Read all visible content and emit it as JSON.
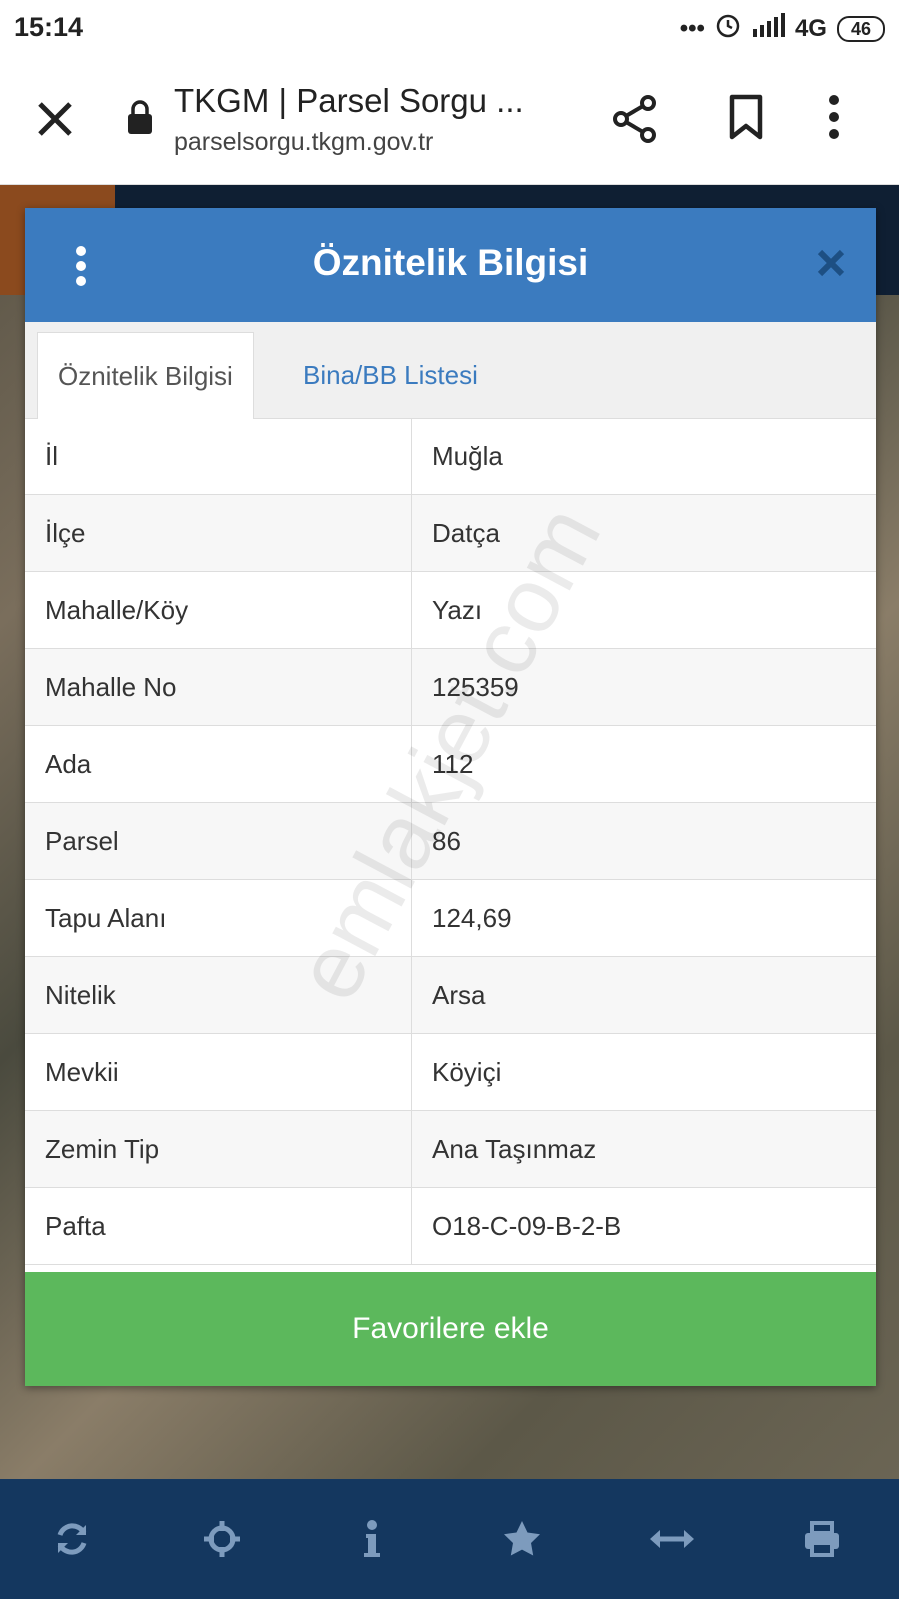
{
  "status": {
    "time": "15:14",
    "network": "4G",
    "battery": "46"
  },
  "browser": {
    "title": "TKGM | Parsel Sorgu ...",
    "url": "parselsorgu.tkgm.gov.tr"
  },
  "dialog": {
    "title": "Öznitelik Bilgisi",
    "tabs": [
      {
        "label": "Öznitelik Bilgisi"
      },
      {
        "label": "Bina/BB Listesi"
      }
    ],
    "rows": [
      {
        "key": "İl",
        "value": "Muğla"
      },
      {
        "key": "İlçe",
        "value": "Datça"
      },
      {
        "key": "Mahalle/Köy",
        "value": "Yazı"
      },
      {
        "key": "Mahalle No",
        "value": "125359"
      },
      {
        "key": "Ada",
        "value": "112"
      },
      {
        "key": "Parsel",
        "value": "86"
      },
      {
        "key": "Tapu Alanı",
        "value": "124,69"
      },
      {
        "key": "Nitelik",
        "value": "Arsa"
      },
      {
        "key": "Mevkii",
        "value": "Köyiçi"
      },
      {
        "key": "Zemin Tip",
        "value": "Ana Taşınmaz"
      },
      {
        "key": "Pafta",
        "value": "O18-C-09-B-2-B"
      }
    ],
    "favorite_label": "Favorilere ekle"
  },
  "watermark": "emlakjet.com",
  "toolbar": {
    "items": [
      "refresh-icon",
      "locate-icon",
      "info-icon",
      "star-icon",
      "measure-icon",
      "print-icon"
    ]
  },
  "colors": {
    "header": "#3b7bbf",
    "tab_link": "#3b7bbf",
    "favorite": "#5cb85c",
    "toolbar": "#14375f"
  }
}
